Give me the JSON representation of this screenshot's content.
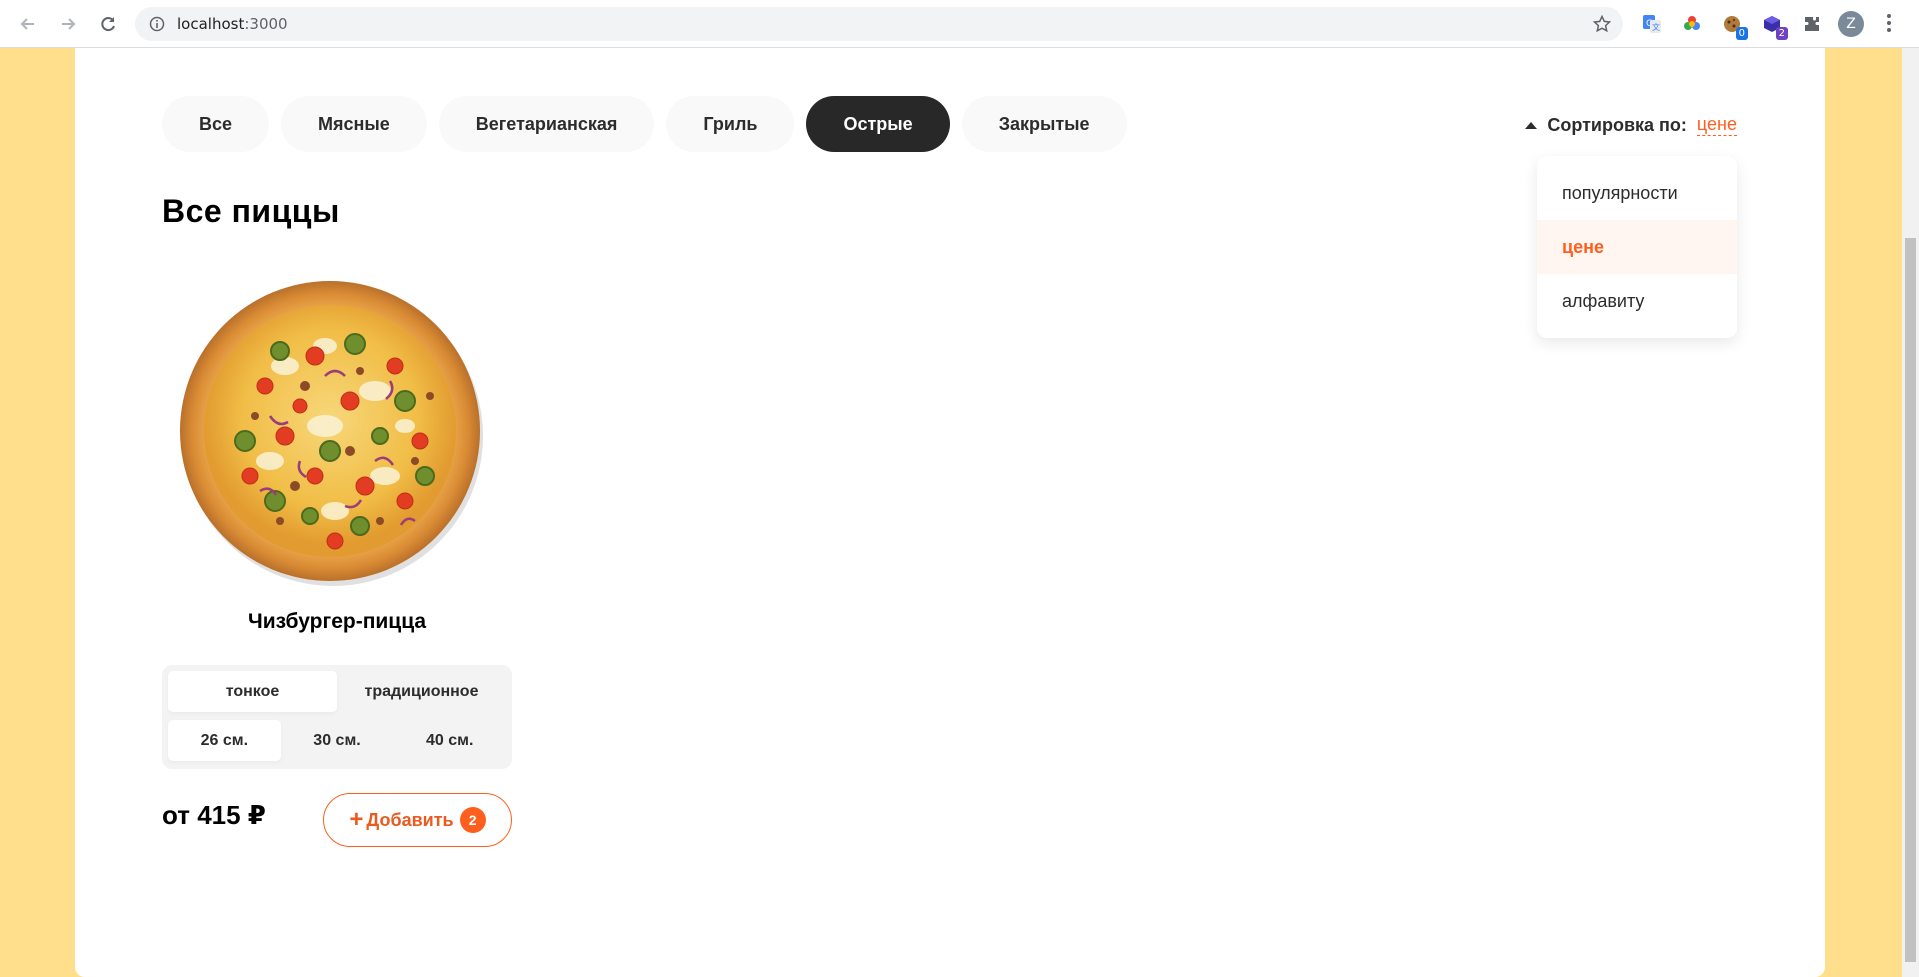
{
  "browser": {
    "url_host": "localhost",
    "url_port": ":3000",
    "profile_initial": "Z",
    "extensions": [
      {
        "name": "translate-icon",
        "badge": ""
      },
      {
        "name": "color-wheel-icon",
        "badge": ""
      },
      {
        "name": "cookie-icon",
        "badge": "0",
        "badge_color": "#1a73e8"
      },
      {
        "name": "cube-icon",
        "badge": "2",
        "badge_color": "#6f42c1"
      },
      {
        "name": "puzzle-icon",
        "badge": ""
      }
    ]
  },
  "categories": {
    "items": [
      {
        "label": "Все",
        "active": false
      },
      {
        "label": "Мясные",
        "active": false
      },
      {
        "label": "Вегетарианская",
        "active": false
      },
      {
        "label": "Гриль",
        "active": false
      },
      {
        "label": "Острые",
        "active": true
      },
      {
        "label": "Закрытые",
        "active": false
      }
    ]
  },
  "sort": {
    "label": "Сортировка по:",
    "value": "цене",
    "options": [
      {
        "label": "популярности",
        "active": false
      },
      {
        "label": "цене",
        "active": true
      },
      {
        "label": "алфавиту",
        "active": false
      }
    ]
  },
  "content": {
    "title": "Все пиццы",
    "pizza": {
      "name": "Чизбургер-пицца",
      "types": [
        {
          "label": "тонкое",
          "active": true
        },
        {
          "label": "традиционное",
          "active": false
        }
      ],
      "sizes": [
        {
          "label": "26 см.",
          "active": true
        },
        {
          "label": "30 см.",
          "active": false
        },
        {
          "label": "40 см.",
          "active": false
        }
      ],
      "price": "от 415 ₽",
      "add_label": "Добавить",
      "add_count": "2"
    }
  },
  "colors": {
    "accent": "#fe5f1e",
    "background": "#ffdf8c",
    "dark": "#282828"
  }
}
